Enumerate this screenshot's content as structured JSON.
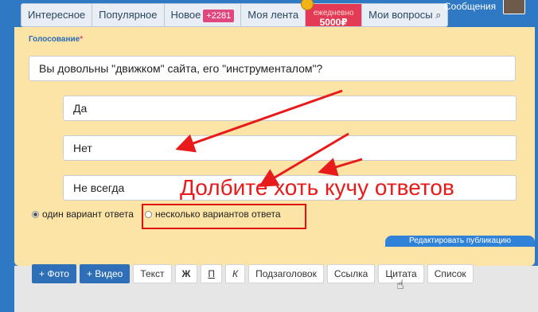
{
  "nav": {
    "tabs": [
      {
        "label": "Интересное"
      },
      {
        "label": "Популярное"
      },
      {
        "label": "Новое",
        "badge": "+2281"
      },
      {
        "label": "Моя лента"
      }
    ],
    "promo": {
      "sub_label": "ежедневно",
      "value": "5000₽"
    },
    "my_questions": "Мои вопросы",
    "messages": "Сообщения"
  },
  "poll": {
    "label": "Голосование",
    "required_mark": "*",
    "question": "Вы довольны \"движком\" сайта, его \"инструменталом\"?",
    "options": [
      "Да",
      "Нет",
      "Не всегда"
    ],
    "radio_single": "один вариант ответа",
    "radio_multi": "несколько вариантов ответа",
    "edit_button": "Редактировать публикацию"
  },
  "annotation": {
    "text": "Долбите хоть кучу ответов",
    "color": "#e81a1a"
  },
  "toolbar": {
    "photo": "+ Фото",
    "video": "+ Видео",
    "text": "Текст",
    "bold": "Ж",
    "underline": "П",
    "italic": "К",
    "subheading": "Подзаголовок",
    "link": "Ссылка",
    "quote": "Цитата",
    "list": "Список"
  },
  "colors": {
    "brand_blue": "#2f78c4",
    "panel_bg": "#fbe4a6",
    "badge_pink": "#e0477d",
    "promo_red": "#e33b55"
  }
}
